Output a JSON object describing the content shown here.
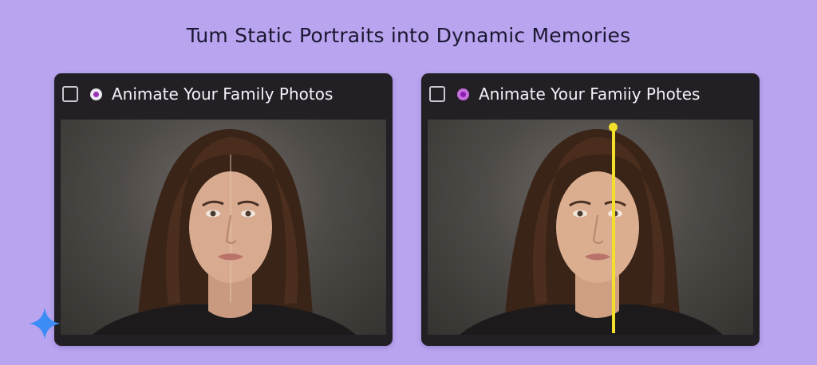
{
  "page": {
    "headline": "Tum Static Portraits into Dynamic Memories"
  },
  "cards": [
    {
      "title": "Animate Your Family Photos",
      "checked": false,
      "photo_icon": "portrait-photo"
    },
    {
      "title": "Animate Your Famiiy Photes",
      "checked": false,
      "photo_icon": "portrait-photo-comparison-slider"
    }
  ],
  "colors": {
    "background": "#b9a4ef",
    "card": "#222024",
    "slider": "#f4df2a",
    "accent_dot": "#9b2fb8",
    "sparkle": "#3b8cf5"
  },
  "icons": {
    "sparkle": "sparkle-icon",
    "radio_dot": "radio-dot-icon",
    "checkbox": "checkbox-icon"
  }
}
